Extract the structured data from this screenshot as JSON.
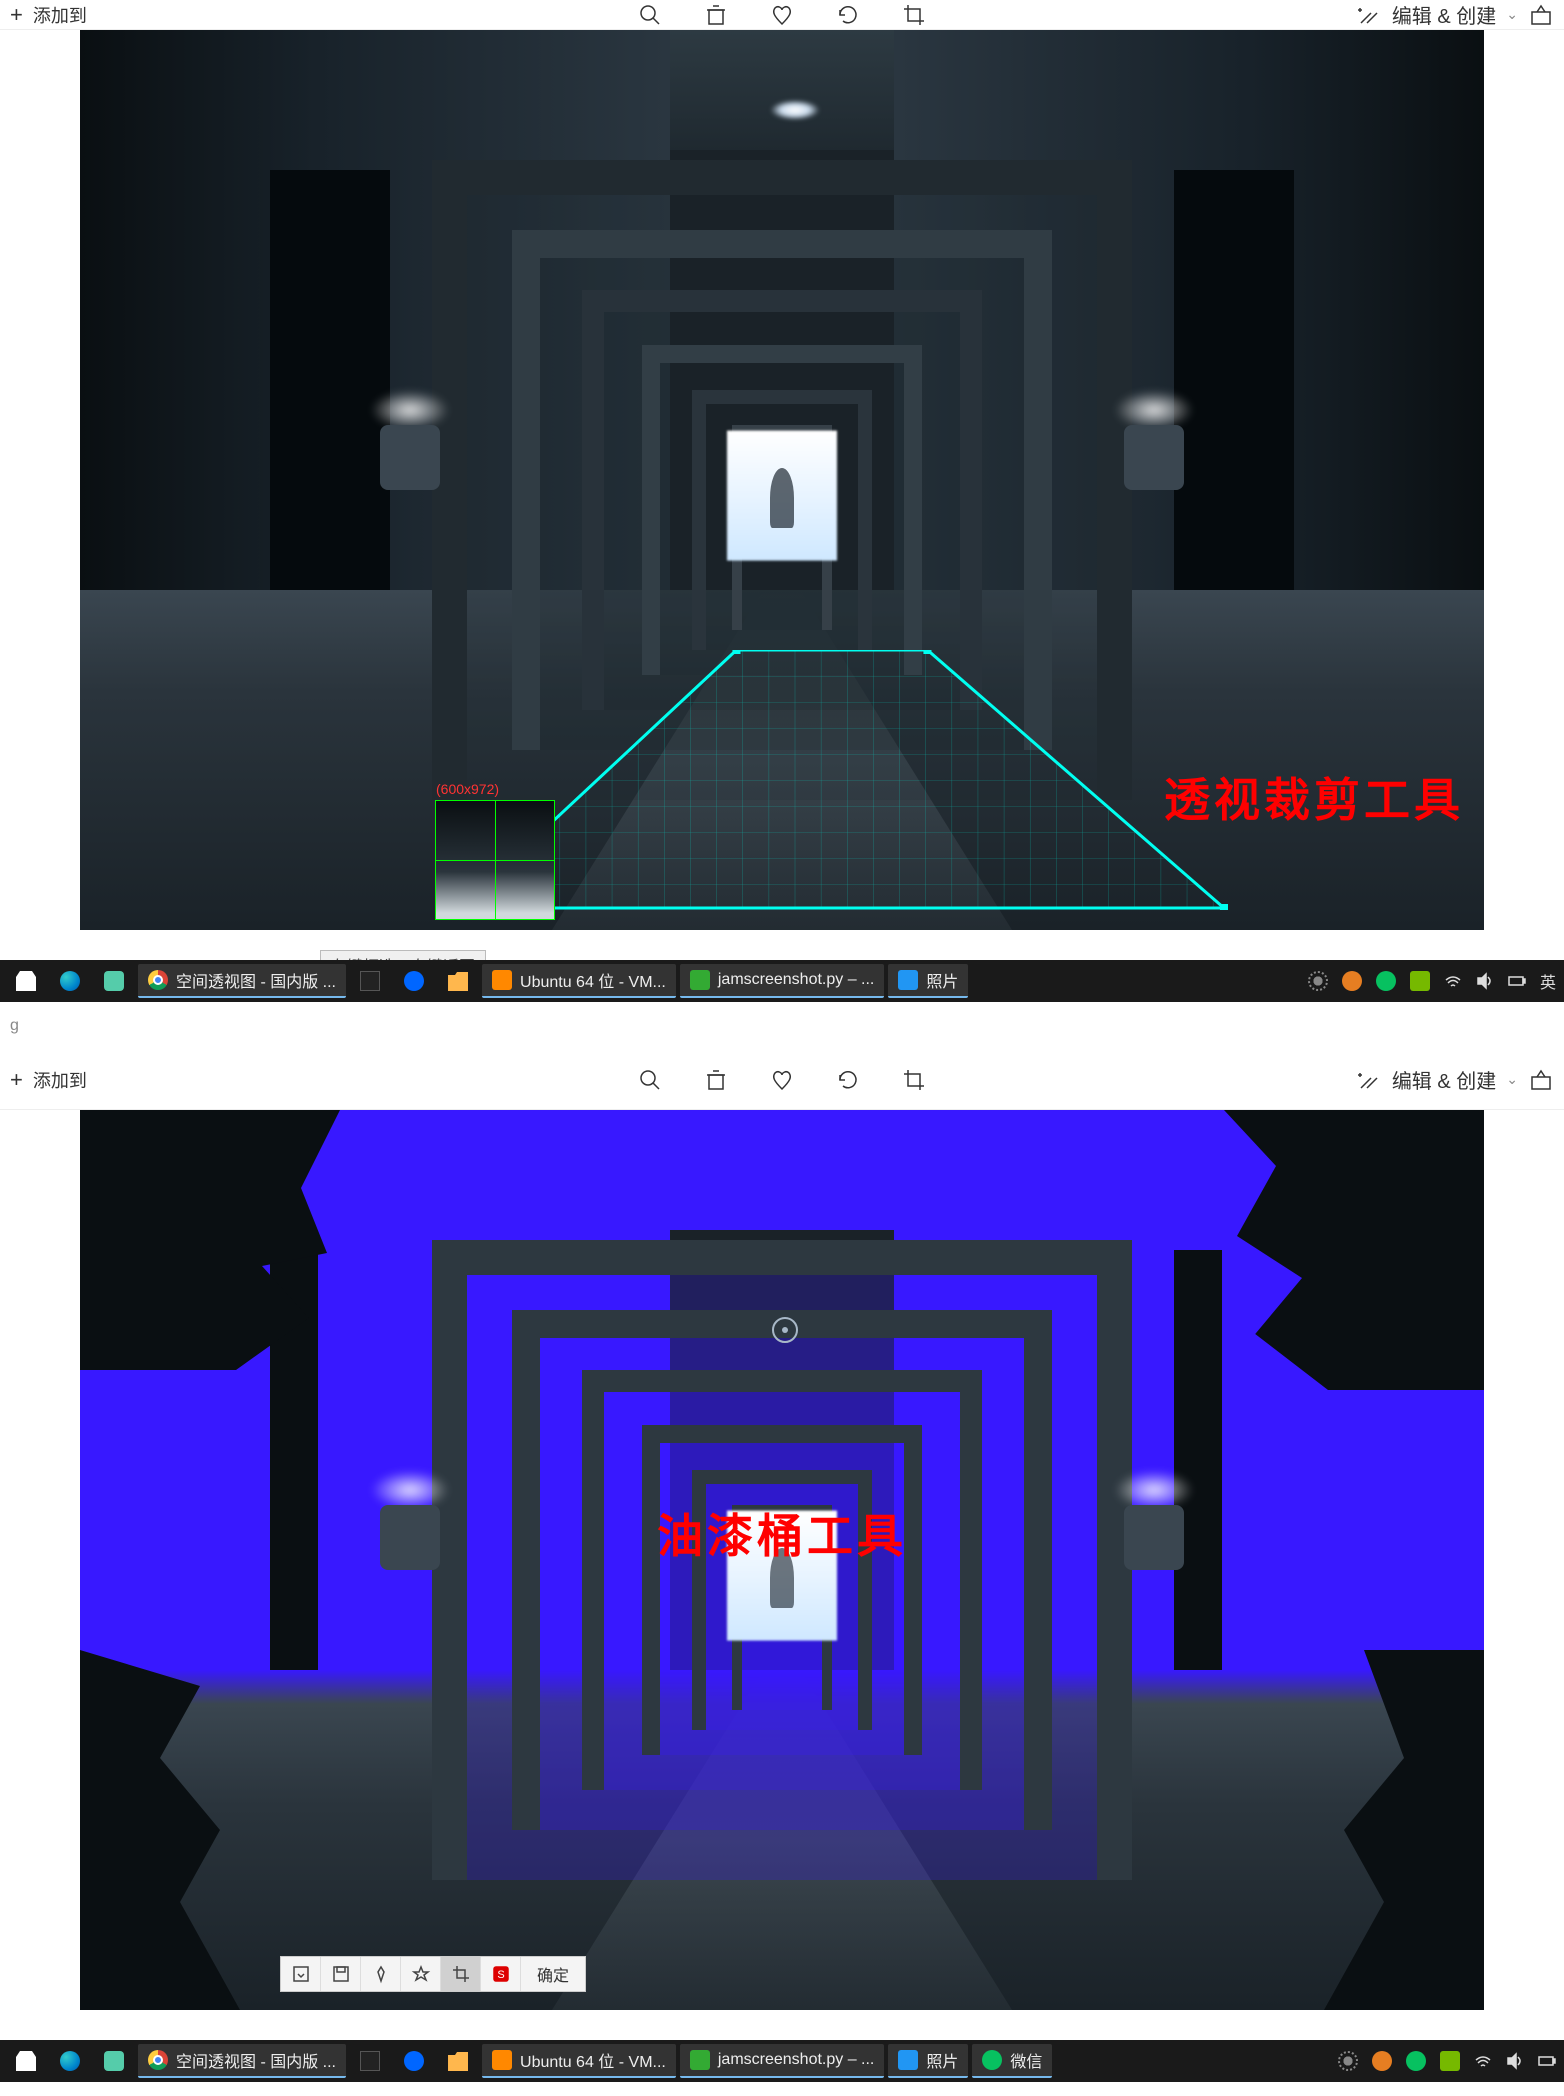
{
  "toolbar": {
    "add_to": "添加到",
    "edit_create": "编辑 & 创建",
    "icons": [
      "zoom",
      "delete",
      "favorite",
      "rotate",
      "crop"
    ]
  },
  "header": {
    "filename": "g"
  },
  "image1": {
    "magnifier_label": "(600x972)",
    "hint": "左键框选，右键返回",
    "annotation": "透视裁剪工具"
  },
  "image2": {
    "annotation": "油漆桶工具",
    "toolstrip": {
      "confirm": "确定",
      "buttons": [
        "export",
        "save",
        "pin",
        "star",
        "crop",
        "stamp"
      ]
    }
  },
  "taskbar": {
    "items": [
      {
        "icon": "store",
        "label": ""
      },
      {
        "icon": "edge",
        "label": ""
      },
      {
        "icon": "chat",
        "label": ""
      },
      {
        "icon": "chrome",
        "label": "空间透视图 - 国内版 ..."
      },
      {
        "icon": "term",
        "label": ""
      },
      {
        "icon": "k",
        "label": ""
      },
      {
        "icon": "folder",
        "label": ""
      },
      {
        "icon": "vm",
        "label": "Ubuntu 64 位 - VM..."
      },
      {
        "icon": "py",
        "label": "jamscreenshot.py – ..."
      },
      {
        "icon": "photo",
        "label": "照片"
      }
    ],
    "items2_extra": {
      "icon": "wechat",
      "label": "微信"
    },
    "ime": "英",
    "tray": [
      "gear",
      "orange",
      "wechat",
      "nvidia",
      "wifi",
      "volume",
      "battery"
    ]
  }
}
